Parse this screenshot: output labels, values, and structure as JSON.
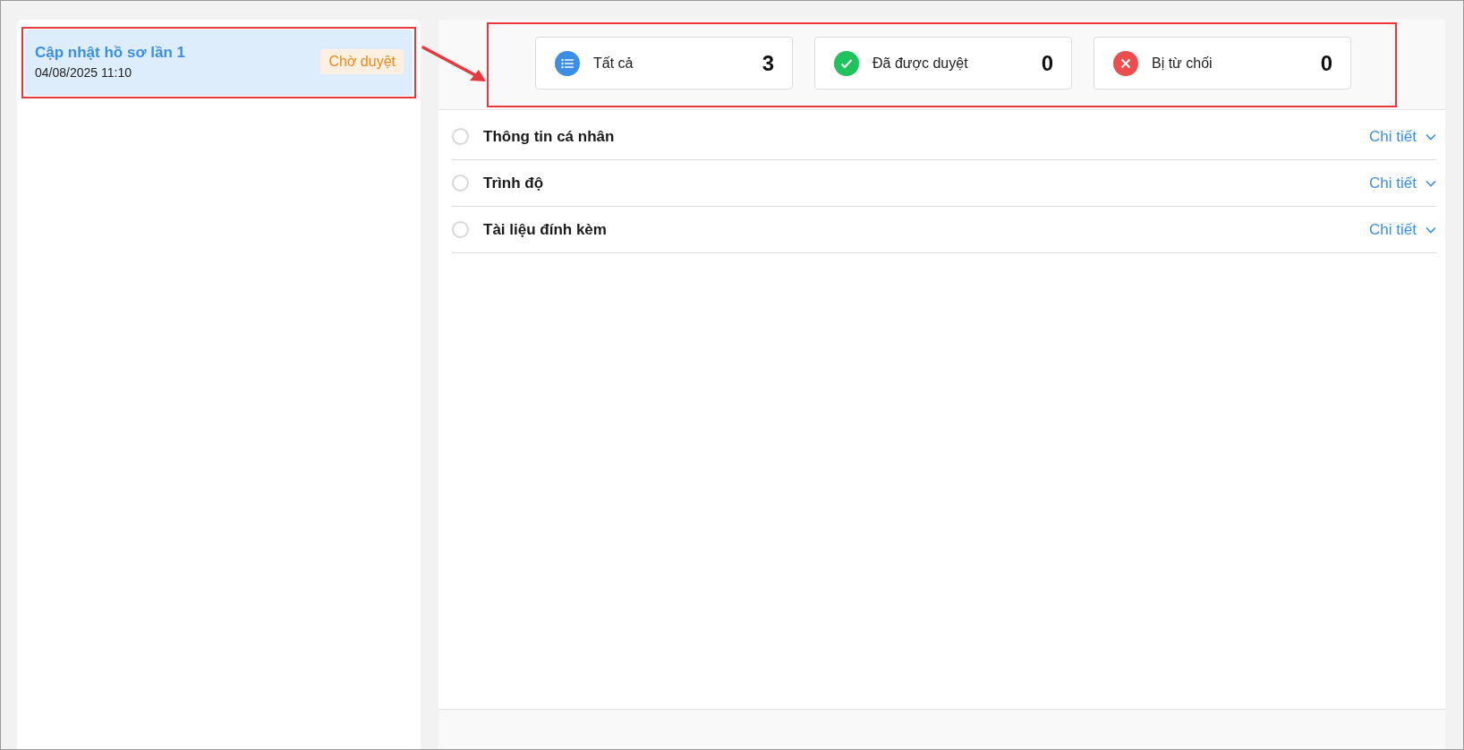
{
  "requests": [
    {
      "title": "Cập nhật hồ sơ lần 1",
      "time": "04/08/2025 11:10",
      "status": "Chờ duyệt",
      "selected": true,
      "highlighted": true
    }
  ],
  "summary": {
    "highlighted": true,
    "cards": [
      {
        "kind": "all",
        "label": "Tất cả",
        "count": "3"
      },
      {
        "kind": "approved",
        "label": "Đã được duyệt",
        "count": "0"
      },
      {
        "kind": "rejected",
        "label": "Bị từ chối",
        "count": "0"
      }
    ]
  },
  "sections": [
    {
      "title": "Thông tin cá nhân",
      "link": "Chi tiết",
      "checked": false,
      "expanded": false
    },
    {
      "title": "Trình độ",
      "link": "Chi tiết",
      "checked": false,
      "expanded": false
    },
    {
      "title": "Tài liệu đính kèm",
      "link": "Chi tiết",
      "checked": false,
      "expanded": false
    }
  ]
}
